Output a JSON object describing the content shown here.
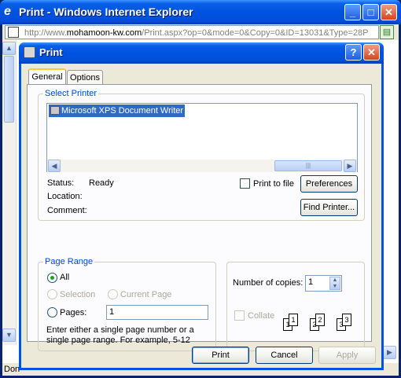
{
  "browser": {
    "title": "Print - Windows Internet Explorer",
    "address_prefix": "http://www.",
    "address_domain": "mohamoon-kw.com",
    "address_rest": "/Print.aspx?op=0&mode=0&Copy=0&ID=13031&Type=28P",
    "status_text": "Don"
  },
  "dialog": {
    "title": "Print",
    "tabs": [
      "General",
      "Options"
    ],
    "select_printer": {
      "title": "Select Printer",
      "printer_name": "Microsoft XPS Document Writer",
      "status_label": "Status:",
      "status_value": "Ready",
      "location_label": "Location:",
      "comment_label": "Comment:",
      "print_to_file_label": "Print to file",
      "preferences_label": "Preferences",
      "find_printer_label": "Find Printer..."
    },
    "page_range": {
      "title": "Page Range",
      "all_label": "All",
      "selection_label": "Selection",
      "current_page_label": "Current Page",
      "pages_label": "Pages:",
      "pages_value": "1",
      "help_text": "Enter either a single page number or a single page range.  For example, 5-12"
    },
    "copies": {
      "label": "Number of copies:",
      "value": "1",
      "collate_label": "Collate"
    },
    "buttons": {
      "print": "Print",
      "cancel": "Cancel",
      "apply": "Apply"
    }
  }
}
